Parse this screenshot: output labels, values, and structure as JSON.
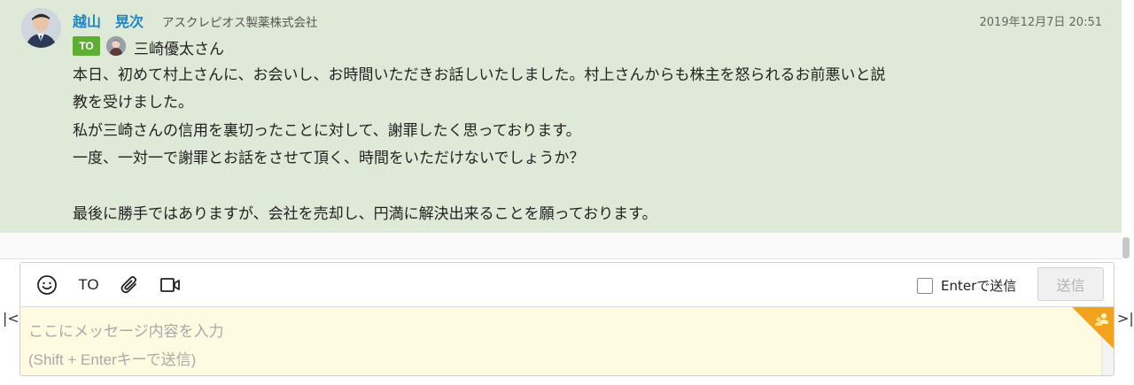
{
  "message": {
    "sender_name": "越山　晃次",
    "sender_company": "アスクレピオス製薬株式会社",
    "timestamp": "2019年12月7日 20:51",
    "to_badge": "TO",
    "to_name": "三崎優太さん",
    "body_lines": [
      "本日、初めて村上さんに、お会いし、お時間いただきお話しいたしました。村上さんからも株主を怒られるお前悪いと説",
      "教を受けました。",
      "私が三崎さんの信用を裏切ったことに対して、謝罪したく思っております。",
      "一度、一対一で謝罪とお話をさせて頂く、時間をいただけないでしょうか？",
      "最後に勝手ではありますが、会社を売却し、円満に解決出来ることを願っております。"
    ]
  },
  "composer": {
    "to_tool_label": "TO",
    "enter_send_label": "Enterで送信",
    "send_button_label": "送信",
    "placeholder_line1": "ここにメッセージ内容を入力",
    "placeholder_line2": "(Shift + Enterキーで送信)"
  },
  "icons": [
    "emoji-icon",
    "attach-icon",
    "video-icon",
    "contact-icon"
  ],
  "nav": {
    "left_arrow": "|<",
    "right_arrow": ">|"
  },
  "colors": {
    "message_bg": "#dfe9d8",
    "name_blue": "#1f86c6",
    "to_green": "#5eae33",
    "input_bg": "#fefbe0",
    "corner_orange": "#f1a31d"
  }
}
